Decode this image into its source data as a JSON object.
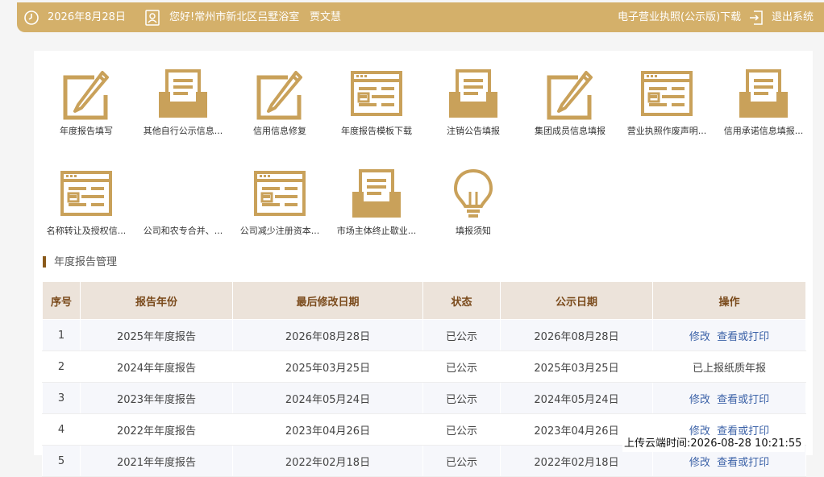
{
  "header": {
    "date": "2026年8月28日",
    "greeting": "您好!常州市新北区吕墅浴室",
    "user": "贾文慧",
    "license_download": "电子营业执照(公示版)下载",
    "logout": "退出系统"
  },
  "tiles": [
    {
      "label": "年度报告填写",
      "icon": "pencil-icon"
    },
    {
      "label": "其他自行公示信息...",
      "icon": "inbox-icon"
    },
    {
      "label": "信用信息修复",
      "icon": "pencil-icon"
    },
    {
      "label": "年度报告模板下载",
      "icon": "browser-form-icon"
    },
    {
      "label": "注销公告填报",
      "icon": "inbox-icon"
    },
    {
      "label": "集团成员信息填报",
      "icon": "pencil-icon"
    },
    {
      "label": "营业执照作废声明...",
      "icon": "browser-form-icon"
    },
    {
      "label": "信用承诺信息填报...",
      "icon": "inbox-icon"
    },
    {
      "label": "名称转让及授权信...",
      "icon": "browser-form-icon"
    },
    {
      "label": "公司和农专合并、...",
      "icon": "none"
    },
    {
      "label": "公司减少注册资本...",
      "icon": "browser-form-icon"
    },
    {
      "label": "市场主体终止歇业...",
      "icon": "inbox-icon"
    },
    {
      "label": "填报须知",
      "icon": "lightbulb-icon"
    }
  ],
  "section": {
    "title": "年度报告管理"
  },
  "table": {
    "headers": [
      "序号",
      "报告年份",
      "最后修改日期",
      "状态",
      "公示日期",
      "操作"
    ],
    "rows": [
      {
        "no": "1",
        "year": "2025年年度报告",
        "modified": "2026年08月28日",
        "status": "已公示",
        "published": "2026年08月28日",
        "action_type": "links",
        "edit": "修改",
        "view": "查看或打印",
        "note": ""
      },
      {
        "no": "2",
        "year": "2024年年度报告",
        "modified": "2025年03月25日",
        "status": "已公示",
        "published": "2025年03月25日",
        "action_type": "text",
        "edit": "",
        "view": "",
        "note": "已上报纸质年报"
      },
      {
        "no": "3",
        "year": "2023年年度报告",
        "modified": "2024年05月24日",
        "status": "已公示",
        "published": "2024年05月24日",
        "action_type": "links",
        "edit": "修改",
        "view": "查看或打印",
        "note": ""
      },
      {
        "no": "4",
        "year": "2022年年度报告",
        "modified": "2023年04月26日",
        "status": "已公示",
        "published": "2023年04月26日",
        "action_type": "links",
        "edit": "修改",
        "view": "查看或打印",
        "note": ""
      },
      {
        "no": "5",
        "year": "2021年年度报告",
        "modified": "2022年02月18日",
        "status": "已公示",
        "published": "2022年02月18日",
        "action_type": "links",
        "edit": "修改",
        "view": "查看或打印",
        "note": ""
      }
    ]
  },
  "upload_stamp": "上传云端时间:2026-08-28 10:21:55",
  "colors": {
    "gold": "#d4b06a",
    "icon": "#c9a15a",
    "header_bg": "#ece3da",
    "header_text": "#7a4a1b",
    "link": "#3d63a8"
  }
}
